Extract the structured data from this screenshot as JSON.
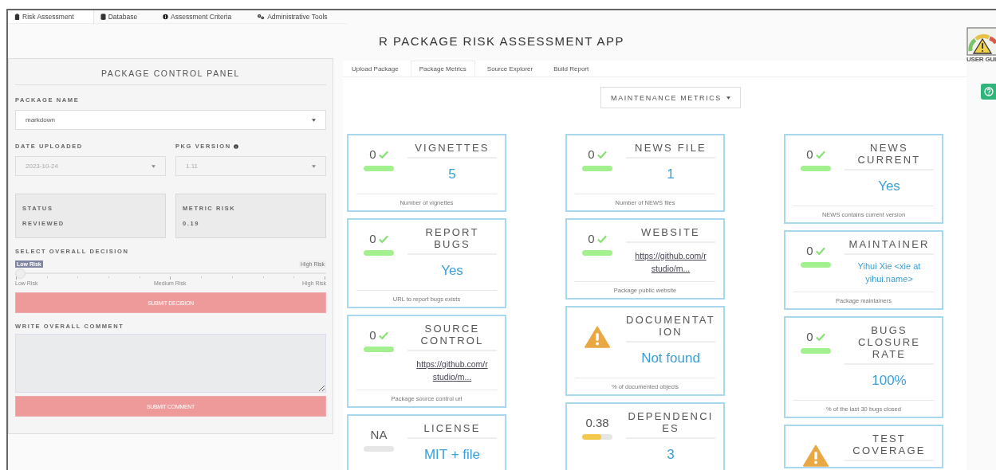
{
  "nav_tabs": [
    {
      "label": "Risk Assessment",
      "selected": true
    },
    {
      "label": "Database",
      "selected": false
    },
    {
      "label": "Assessment Criteria",
      "selected": false
    },
    {
      "label": "Administrative Tools",
      "selected": false
    }
  ],
  "app_title": "R PACKAGE RISK ASSESSMENT APP",
  "user_guide": {
    "label": "USER GUI"
  },
  "control_panel": {
    "title": "PACKAGE CONTROL PANEL",
    "package_name": {
      "label": "PACKAGE NAME",
      "value": "markdown",
      "disabled": false
    },
    "date_uploaded": {
      "label": "DATE UPLOADED",
      "value": "2023-10-24",
      "disabled": true
    },
    "pkg_version": {
      "label": "PKG VERSION",
      "value": "1.11",
      "disabled": true
    },
    "status": {
      "label": "STATUS",
      "value": "REVIEWED"
    },
    "metric_risk": {
      "label": "METRIC RISK",
      "value": "0.19"
    },
    "decision": {
      "label": "SELECT OVERALL DECISION",
      "value_badge": "Low Risk",
      "max_badge": "High Risk",
      "level": 0,
      "tick_labels": [
        "Low Risk",
        "Medium Risk",
        "High Risk"
      ]
    },
    "submit_decision": "SUBMIT DECISION",
    "comment": {
      "label": "WRITE OVERALL COMMENT"
    },
    "submit_comment": "SUBMIT COMMENT"
  },
  "sub_tabs": [
    {
      "label": "Upload Package",
      "selected": false
    },
    {
      "label": "Package Metrics",
      "selected": true
    },
    {
      "label": "Source Explorer",
      "selected": false
    },
    {
      "label": "Build Report",
      "selected": false
    }
  ],
  "metrics_dropdown": "MAINTENANCE METRICS",
  "metric_columns": [
    {
      "cards": [
        {
          "kind": "score",
          "score": "0",
          "passed": true,
          "level": 1,
          "color": "#a3f08f",
          "title": "VIGNETTES",
          "value": {
            "kind": "text",
            "text": "5"
          },
          "footer": "Number of vignettes"
        },
        {
          "kind": "score",
          "score": "0",
          "passed": true,
          "level": 1,
          "color": "#a3f08f",
          "title": "REPORT BUGS",
          "value": {
            "kind": "text",
            "text": "Yes"
          },
          "footer": "URL to report bugs exists"
        },
        {
          "kind": "score",
          "score": "0",
          "passed": true,
          "level": 1,
          "color": "#a3f08f",
          "title": "SOURCE CONTROL",
          "value": {
            "kind": "link",
            "text": "https://github.com/rstudio/m..."
          },
          "footer": "Package source control url"
        },
        {
          "kind": "score",
          "score": "NA",
          "passed": false,
          "title": "LICENSE",
          "value": {
            "kind": "text",
            "text": "MIT + file"
          }
        }
      ]
    },
    {
      "cards": [
        {
          "kind": "score",
          "score": "0",
          "passed": true,
          "level": 1,
          "color": "#a3f08f",
          "title": "NEWS FILE",
          "value": {
            "kind": "text",
            "text": "1"
          },
          "footer": "Number of NEWS files"
        },
        {
          "kind": "score",
          "score": "0",
          "passed": true,
          "level": 1,
          "color": "#a3f08f",
          "title": "WEBSITE",
          "value": {
            "kind": "link",
            "text": "https://github.com/rstudio/m..."
          },
          "footer": "Package public website"
        },
        {
          "kind": "warning",
          "title": "DOCUMENTATION",
          "value": {
            "kind": "text",
            "text": "Not found"
          },
          "footer": "% of documented objects"
        },
        {
          "kind": "score",
          "score": "0.38",
          "passed": false,
          "level": 0.63,
          "color": "#f2c94c",
          "title": "DEPENDENCIES",
          "value": {
            "kind": "text",
            "text": "3"
          }
        }
      ]
    },
    {
      "cards": [
        {
          "kind": "score",
          "score": "0",
          "passed": true,
          "level": 1,
          "color": "#a3f08f",
          "title": "NEWS CURRENT",
          "value": {
            "kind": "text",
            "text": "Yes"
          },
          "footer": "NEWS contains current version"
        },
        {
          "kind": "score",
          "score": "0",
          "passed": true,
          "level": 1,
          "color": "#a3f08f",
          "title": "MAINTAINER",
          "value": {
            "kind": "small",
            "text": "Yihui Xie <xie at yihui.name>"
          },
          "footer": "Package maintainers"
        },
        {
          "kind": "score",
          "score": "0",
          "passed": true,
          "level": 1,
          "color": "#a3f08f",
          "title": "BUGS CLOSURE RATE",
          "value": {
            "kind": "text",
            "text": "100%"
          },
          "footer": "% of the last 30 bugs closed"
        },
        {
          "kind": "warning",
          "title": "TEST COVERAGE"
        }
      ]
    }
  ]
}
